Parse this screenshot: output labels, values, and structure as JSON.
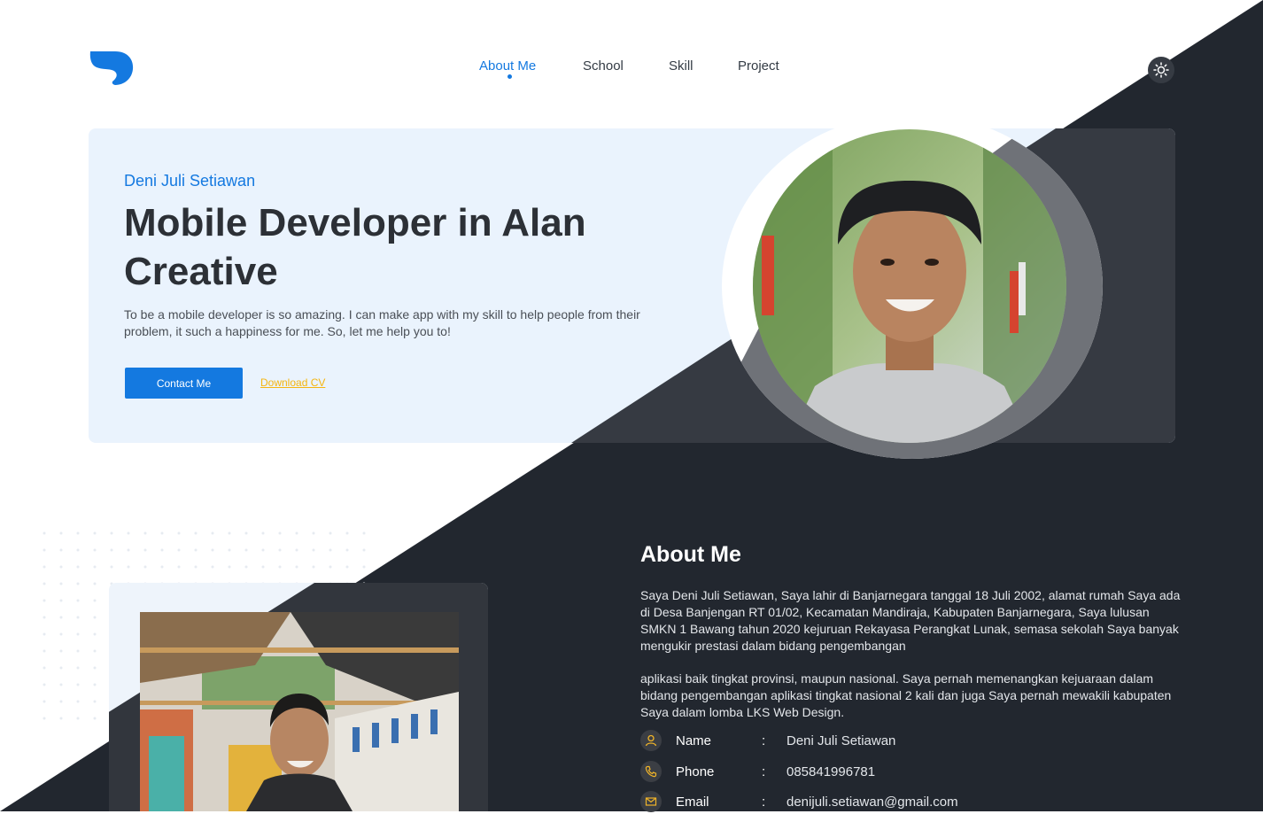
{
  "colors": {
    "accent": "#1479e0",
    "dark_bg": "#22272f",
    "light_bg": "#ffffff",
    "hero_light": "#eaf3fd",
    "download_link": "#f5b50f",
    "icon_gold": "#f0b429"
  },
  "logo": {
    "icon": "brand-logo-icon"
  },
  "nav": {
    "items": [
      {
        "label": "About Me",
        "active": true
      },
      {
        "label": "School",
        "active": false
      },
      {
        "label": "Skill",
        "active": false
      },
      {
        "label": "Project",
        "active": false
      }
    ],
    "theme_toggle_icon": "sun-icon"
  },
  "hero": {
    "name": "Deni Juli Setiawan",
    "title": "Mobile Developer in Alan Creative",
    "description": "To be a mobile developer is so amazing. I can make app with my skill to help people from their problem, it such a happiness for me. So, let me help you to!",
    "contact_button": "Contact Me",
    "download_link": "Download CV"
  },
  "about": {
    "heading": "About Me",
    "paragraph1": "Saya Deni Juli Setiawan, Saya lahir di Banjarnegara tanggal 18 Juli 2002, alamat rumah Saya ada di Desa Banjengan RT 01/02, Kecamatan Mandiraja, Kabupaten Banjarnegara, Saya lulusan SMKN 1 Bawang tahun 2020 kejuruan Rekayasa Perangkat Lunak, semasa sekolah Saya banyak mengukir prestasi dalam bidang pengembangan",
    "paragraph2": "aplikasi baik tingkat provinsi, maupun nasional. Saya pernah memenangkan kejuaraan dalam bidang pengembangan aplikasi tingkat nasional 2 kali dan juga Saya pernah mewakili kabupaten Saya dalam lomba LKS Web Design.",
    "info": [
      {
        "icon": "user-icon",
        "label": "Name",
        "separator": ":",
        "value": "Deni Juli Setiawan"
      },
      {
        "icon": "phone-icon",
        "label": "Phone",
        "separator": ":",
        "value": "085841996781"
      },
      {
        "icon": "mail-icon",
        "label": "Email",
        "separator": ":",
        "value": "denijuli.setiawan@gmail.com"
      }
    ]
  }
}
